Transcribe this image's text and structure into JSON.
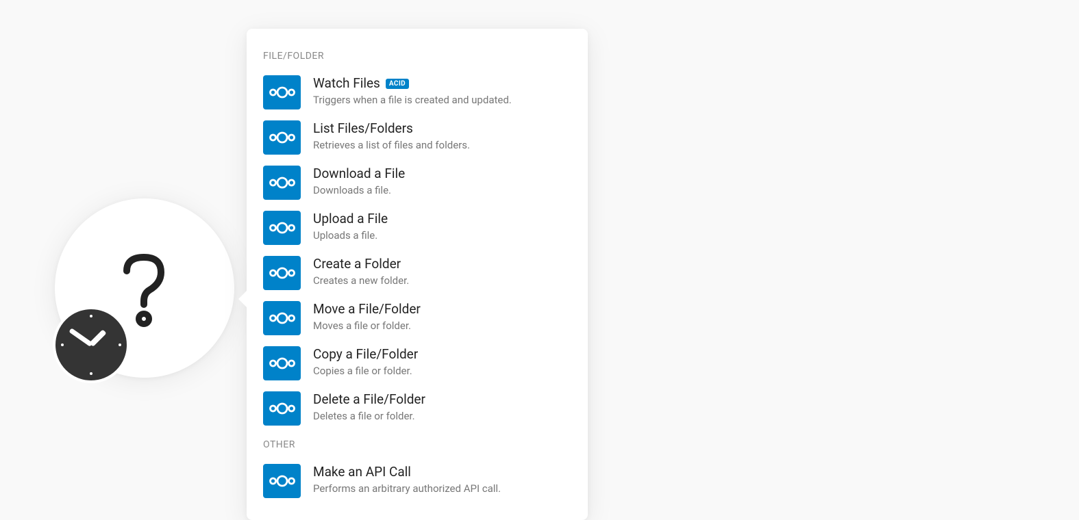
{
  "node_icon": "question-clock-icon",
  "panel": {
    "sections": [
      {
        "heading": "FILE/FOLDER",
        "items": [
          {
            "title": "Watch Files",
            "badge": "ACID",
            "desc": "Triggers when a file is created and updated.",
            "name": "action-watch-files"
          },
          {
            "title": "List Files/Folders",
            "badge": "",
            "desc": "Retrieves a list of files and folders.",
            "name": "action-list-files-folders"
          },
          {
            "title": "Download a File",
            "badge": "",
            "desc": "Downloads a file.",
            "name": "action-download-file"
          },
          {
            "title": "Upload a File",
            "badge": "",
            "desc": "Uploads a file.",
            "name": "action-upload-file"
          },
          {
            "title": "Create a Folder",
            "badge": "",
            "desc": "Creates a new folder.",
            "name": "action-create-folder"
          },
          {
            "title": "Move a File/Folder",
            "badge": "",
            "desc": "Moves a file or folder.",
            "name": "action-move-file-folder"
          },
          {
            "title": "Copy a File/Folder",
            "badge": "",
            "desc": "Copies a file or folder.",
            "name": "action-copy-file-folder"
          },
          {
            "title": "Delete a File/Folder",
            "badge": "",
            "desc": "Deletes a file or folder.",
            "name": "action-delete-file-folder"
          }
        ]
      },
      {
        "heading": "OTHER",
        "items": [
          {
            "title": "Make an API Call",
            "badge": "",
            "desc": "Performs an arbitrary authorized API call.",
            "name": "action-make-api-call"
          }
        ]
      }
    ]
  },
  "colors": {
    "app_icon_bg": "#0082c9",
    "panel_bg": "#ffffff"
  }
}
